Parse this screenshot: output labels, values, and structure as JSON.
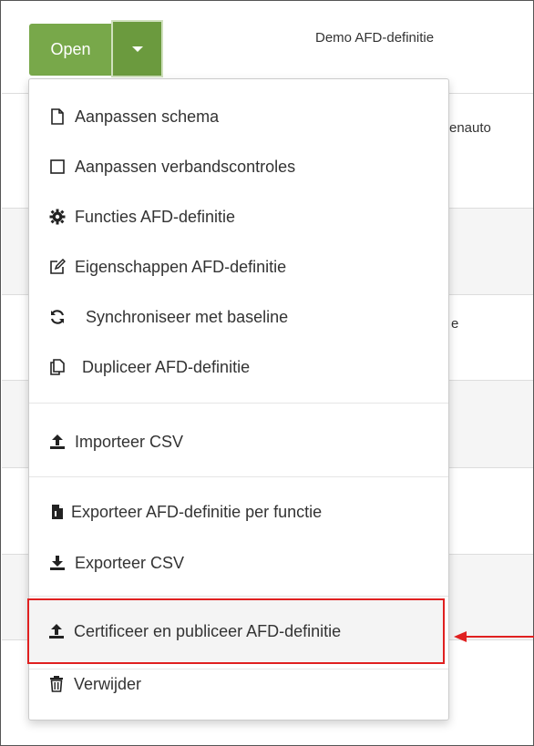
{
  "split_button": {
    "open_label": "Open"
  },
  "row_title": "Demo AFD-definitie",
  "background_fragments": [
    "enauto",
    "e"
  ],
  "menu": {
    "items": [
      {
        "label": "Aanpassen schema",
        "icon": "file-outline-icon"
      },
      {
        "label": "Aanpassen verbandscontroles",
        "icon": "square-outline-icon"
      },
      {
        "label": "Functies AFD-definitie",
        "icon": "gear-icon"
      },
      {
        "label": "Eigenschappen AFD-definitie",
        "icon": "edit-icon"
      },
      {
        "label": "Synchroniseer met baseline",
        "icon": "sync-icon"
      },
      {
        "label": "Dupliceer AFD-definitie",
        "icon": "copy-icon"
      },
      {
        "label": "Importeer CSV",
        "icon": "upload-icon"
      },
      {
        "label": "Exporteer AFD-definitie per functie",
        "icon": "file-export-icon"
      },
      {
        "label": "Exporteer CSV",
        "icon": "download-icon"
      },
      {
        "label": "Certificeer en publiceer AFD-definitie",
        "icon": "upload-icon"
      },
      {
        "label": "Verwijder",
        "icon": "trash-icon"
      }
    ]
  },
  "colors": {
    "primary": "#78a84a",
    "primary_dark": "#6b9a3e",
    "highlight": "#e02020"
  }
}
